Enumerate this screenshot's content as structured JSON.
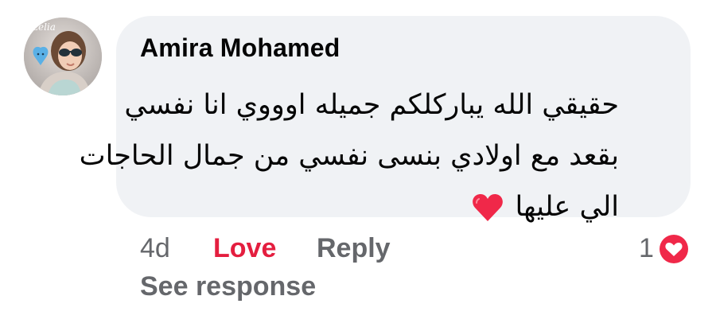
{
  "comment": {
    "author": "Amira Mohamed",
    "text_lines": [
      "حقيقي الله يباركلكم جميله اوووي انا نفسي",
      "بقعد مع اولادي بنسى نفسي من جمال الحاجات",
      "الي عليها"
    ],
    "trailing_emoji": "red-heart-emoji",
    "avatar_overlay_text": "Lelia"
  },
  "actions": {
    "time": "4d",
    "love": "Love",
    "reply": "Reply"
  },
  "reactions": {
    "count": "1",
    "icon": "heart-reaction-icon"
  },
  "see_response": "See response",
  "colors": {
    "bubble": "#f0f2f5",
    "love": "#e41e3f",
    "secondary_text": "#65676b",
    "primary_text": "#050505",
    "heart": "#f02849"
  }
}
